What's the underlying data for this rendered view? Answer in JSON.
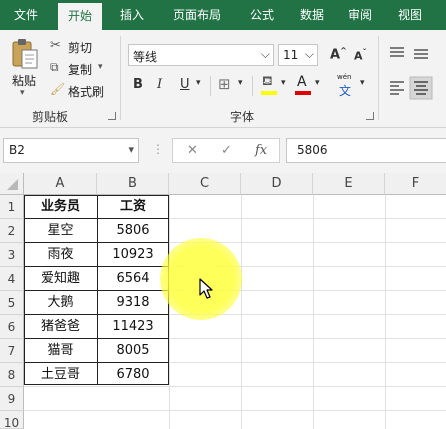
{
  "tabs": [
    "文件",
    "开始",
    "插入",
    "页面布局",
    "公式",
    "数据",
    "审阅",
    "视图"
  ],
  "active_tab": "开始",
  "clipboard": {
    "paste": "粘贴",
    "cut": "剪切",
    "copy": "复制",
    "format_painter": "格式刷",
    "group_label": "剪贴板"
  },
  "font": {
    "family": "等线",
    "size": "11",
    "group_label": "字体",
    "bold": "B",
    "italic": "I",
    "underline": "U",
    "grow": "A",
    "shrink": "A",
    "font_color_glyph": "A",
    "phonetic_glyph": "wén",
    "phonetic_char": "文"
  },
  "formula_bar": {
    "cell_ref": "B2",
    "fx": "fx",
    "value": "5806"
  },
  "columns": [
    "A",
    "B",
    "C",
    "D",
    "E",
    "F"
  ],
  "rows": [
    "1",
    "2",
    "3",
    "4",
    "5",
    "6",
    "7",
    "8",
    "9",
    "10"
  ],
  "table": {
    "headers": [
      "业务员",
      "工资"
    ],
    "rows": [
      [
        "星空",
        "5806"
      ],
      [
        "雨夜",
        "10923"
      ],
      [
        "爱知趣",
        "6564"
      ],
      [
        "大鹅",
        "9318"
      ],
      [
        "猪爸爸",
        "11423"
      ],
      [
        "猫哥",
        "8005"
      ],
      [
        "土豆哥",
        "6780"
      ]
    ]
  },
  "colors": {
    "ribbon_green": "#217346",
    "highlight": "#ffff50"
  }
}
